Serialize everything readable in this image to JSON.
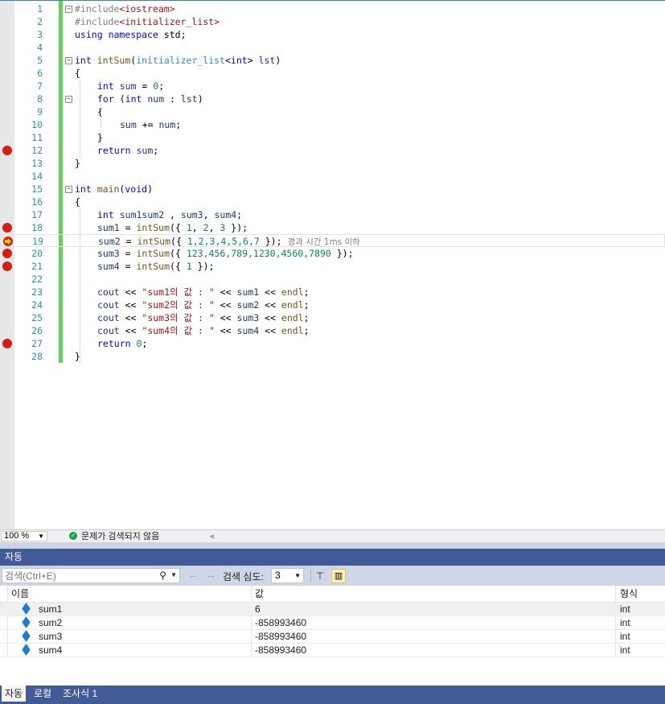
{
  "editor": {
    "lines": [
      {
        "n": "1",
        "tokens": [
          [
            "inc",
            "#include"
          ],
          [
            "str",
            "<iostream>"
          ]
        ],
        "indent": 0,
        "fold": "-"
      },
      {
        "n": "2",
        "tokens": [
          [
            "inc",
            "#include"
          ],
          [
            "str",
            "<initializer_list>"
          ]
        ],
        "indent": 0
      },
      {
        "n": "3",
        "tokens": [
          [
            "kw",
            "using"
          ],
          [
            "",
            "&nbsp;"
          ],
          [
            "kw",
            "namespace"
          ],
          [
            "",
            " std;"
          ]
        ],
        "indent": 0
      },
      {
        "n": "4",
        "tokens": [],
        "indent": 0
      },
      {
        "n": "5",
        "tokens": [
          [
            "kw",
            "int"
          ],
          [
            "",
            " "
          ],
          [
            "fn",
            "intSum"
          ],
          [
            "",
            "("
          ],
          [
            "ty",
            "initializer_list"
          ],
          [
            "",
            "<"
          ],
          [
            "kw",
            "int"
          ],
          [
            "",
            "> "
          ],
          [
            "var",
            "lst"
          ],
          [
            "",
            ")"
          ]
        ],
        "indent": 0,
        "fold": "-"
      },
      {
        "n": "6",
        "tokens": [
          [
            "",
            "{"
          ]
        ],
        "indent": 0
      },
      {
        "n": "7",
        "tokens": [
          [
            "kw",
            "int"
          ],
          [
            "",
            " "
          ],
          [
            "var",
            "sum"
          ],
          [
            "",
            " = "
          ],
          [
            "num",
            "0"
          ],
          [
            "",
            ";"
          ]
        ],
        "indent": 1
      },
      {
        "n": "8",
        "tokens": [
          [
            "kw",
            "for"
          ],
          [
            "",
            " ("
          ],
          [
            "kw",
            "int"
          ],
          [
            "",
            " "
          ],
          [
            "var",
            "num"
          ],
          [
            "",
            " : "
          ],
          [
            "var",
            "lst"
          ],
          [
            "",
            ")"
          ]
        ],
        "indent": 1,
        "fold": "-"
      },
      {
        "n": "9",
        "tokens": [
          [
            "",
            "{"
          ]
        ],
        "indent": 1
      },
      {
        "n": "10",
        "tokens": [
          [
            "var",
            "sum"
          ],
          [
            "",
            " += "
          ],
          [
            "var",
            "num"
          ],
          [
            "",
            ";"
          ]
        ],
        "indent": 2
      },
      {
        "n": "11",
        "tokens": [
          [
            "",
            "}"
          ]
        ],
        "indent": 1
      },
      {
        "n": "12",
        "tokens": [
          [
            "kw",
            "return"
          ],
          [
            "",
            " "
          ],
          [
            "var",
            "sum"
          ],
          [
            "",
            ";"
          ]
        ],
        "indent": 1,
        "bp": true
      },
      {
        "n": "13",
        "tokens": [
          [
            "",
            "}"
          ]
        ],
        "indent": 0
      },
      {
        "n": "14",
        "tokens": [],
        "indent": 0
      },
      {
        "n": "15",
        "tokens": [
          [
            "kw",
            "int"
          ],
          [
            "",
            " "
          ],
          [
            "fn",
            "main"
          ],
          [
            "",
            "("
          ],
          [
            "kw",
            "void"
          ],
          [
            "",
            ")"
          ]
        ],
        "indent": 0,
        "fold": "-"
      },
      {
        "n": "16",
        "tokens": [
          [
            "",
            "{"
          ]
        ],
        "indent": 0
      },
      {
        "n": "17",
        "tokens": [
          [
            "kw",
            "int"
          ],
          [
            "",
            " "
          ],
          [
            "var",
            "sum1"
          ],
          [
            ", "
          ],
          [
            "var",
            "sum2"
          ],
          [
            "",
            " , "
          ],
          [
            "var",
            "sum3"
          ],
          [
            "",
            ", "
          ],
          [
            "var",
            "sum4"
          ],
          [
            "",
            ";"
          ]
        ],
        "indent": 1
      },
      {
        "n": "18",
        "tokens": [
          [
            "var",
            "sum1"
          ],
          [
            "",
            " = "
          ],
          [
            "fn",
            "intSum"
          ],
          [
            "",
            "({ "
          ],
          [
            "num",
            "1"
          ],
          [
            "",
            ", "
          ],
          [
            "num",
            "2"
          ],
          [
            "",
            ", "
          ],
          [
            "num",
            "3"
          ],
          [
            "",
            " });"
          ]
        ],
        "indent": 1,
        "bp": true
      },
      {
        "n": "19",
        "tokens": [
          [
            "var",
            "sum2"
          ],
          [
            "",
            " = "
          ],
          [
            "fn",
            "intSum"
          ],
          [
            "",
            "({ "
          ],
          [
            "num",
            "1,2,3,4,5,6,7"
          ],
          [
            "",
            " }); "
          ]
        ],
        "indent": 1,
        "cur": true,
        "hint": "경과 시간 1ms 이하"
      },
      {
        "n": "20",
        "tokens": [
          [
            "var",
            "sum3"
          ],
          [
            "",
            " = "
          ],
          [
            "fn",
            "intSum"
          ],
          [
            "",
            "({ "
          ],
          [
            "num",
            "123,456,789,1230,4560,7890"
          ],
          [
            "",
            " });"
          ]
        ],
        "indent": 1,
        "bp": true
      },
      {
        "n": "21",
        "tokens": [
          [
            "var",
            "sum4"
          ],
          [
            "",
            " = "
          ],
          [
            "fn",
            "intSum"
          ],
          [
            "",
            "({ "
          ],
          [
            "num",
            "1"
          ],
          [
            "",
            " });"
          ]
        ],
        "indent": 1,
        "bp": true
      },
      {
        "n": "22",
        "tokens": [],
        "indent": 1
      },
      {
        "n": "23",
        "tokens": [
          [
            "var",
            "cout"
          ],
          [
            "",
            " << "
          ],
          [
            "str",
            "\"sum1의 값 : \""
          ],
          [
            "",
            " << "
          ],
          [
            "var",
            "sum1"
          ],
          [
            "",
            " << "
          ],
          [
            "fn",
            "endl"
          ],
          [
            "",
            ";"
          ]
        ],
        "indent": 1
      },
      {
        "n": "24",
        "tokens": [
          [
            "var",
            "cout"
          ],
          [
            "",
            " << "
          ],
          [
            "str",
            "\"sum2의 값 : \""
          ],
          [
            "",
            " << "
          ],
          [
            "var",
            "sum2"
          ],
          [
            "",
            " << "
          ],
          [
            "fn",
            "endl"
          ],
          [
            "",
            ";"
          ]
        ],
        "indent": 1
      },
      {
        "n": "25",
        "tokens": [
          [
            "var",
            "cout"
          ],
          [
            "",
            " << "
          ],
          [
            "str",
            "\"sum3의 값 : \""
          ],
          [
            "",
            " << "
          ],
          [
            "var",
            "sum3"
          ],
          [
            "",
            " << "
          ],
          [
            "fn",
            "endl"
          ],
          [
            "",
            ";"
          ]
        ],
        "indent": 1
      },
      {
        "n": "26",
        "tokens": [
          [
            "var",
            "cout"
          ],
          [
            "",
            " << "
          ],
          [
            "str",
            "\"sum4의 값 : \""
          ],
          [
            "",
            " << "
          ],
          [
            "var",
            "sum4"
          ],
          [
            "",
            " << "
          ],
          [
            "fn",
            "endl"
          ],
          [
            "",
            ";"
          ]
        ],
        "indent": 1
      },
      {
        "n": "27",
        "tokens": [
          [
            "kw",
            "return"
          ],
          [
            "",
            " "
          ],
          [
            "num",
            "0"
          ],
          [
            "",
            ";"
          ]
        ],
        "indent": 1,
        "bp": true
      },
      {
        "n": "28",
        "tokens": [
          [
            "",
            "}"
          ]
        ],
        "indent": 0
      }
    ]
  },
  "status": {
    "zoom": "100 %",
    "issues": "문제가 검색되지 않음"
  },
  "auto_panel": {
    "title": "자동",
    "search_placeholder": "검색(Ctrl+E)",
    "depth_label": "검색 심도:",
    "depth_value": "3",
    "columns": [
      "이름",
      "값",
      "형식"
    ],
    "rows": [
      {
        "name": "sum1",
        "value": "6",
        "type": "int"
      },
      {
        "name": "sum2",
        "value": "-858993460",
        "type": "int"
      },
      {
        "name": "sum3",
        "value": "-858993460",
        "type": "int"
      },
      {
        "name": "sum4",
        "value": "-858993460",
        "type": "int"
      }
    ]
  },
  "bottom_tabs": [
    "자동",
    "로컬",
    "조사식 1"
  ],
  "colors": {
    "breakpoint": "#d41f10",
    "changebar": "#61d15a",
    "panel_header": "#425b97"
  }
}
